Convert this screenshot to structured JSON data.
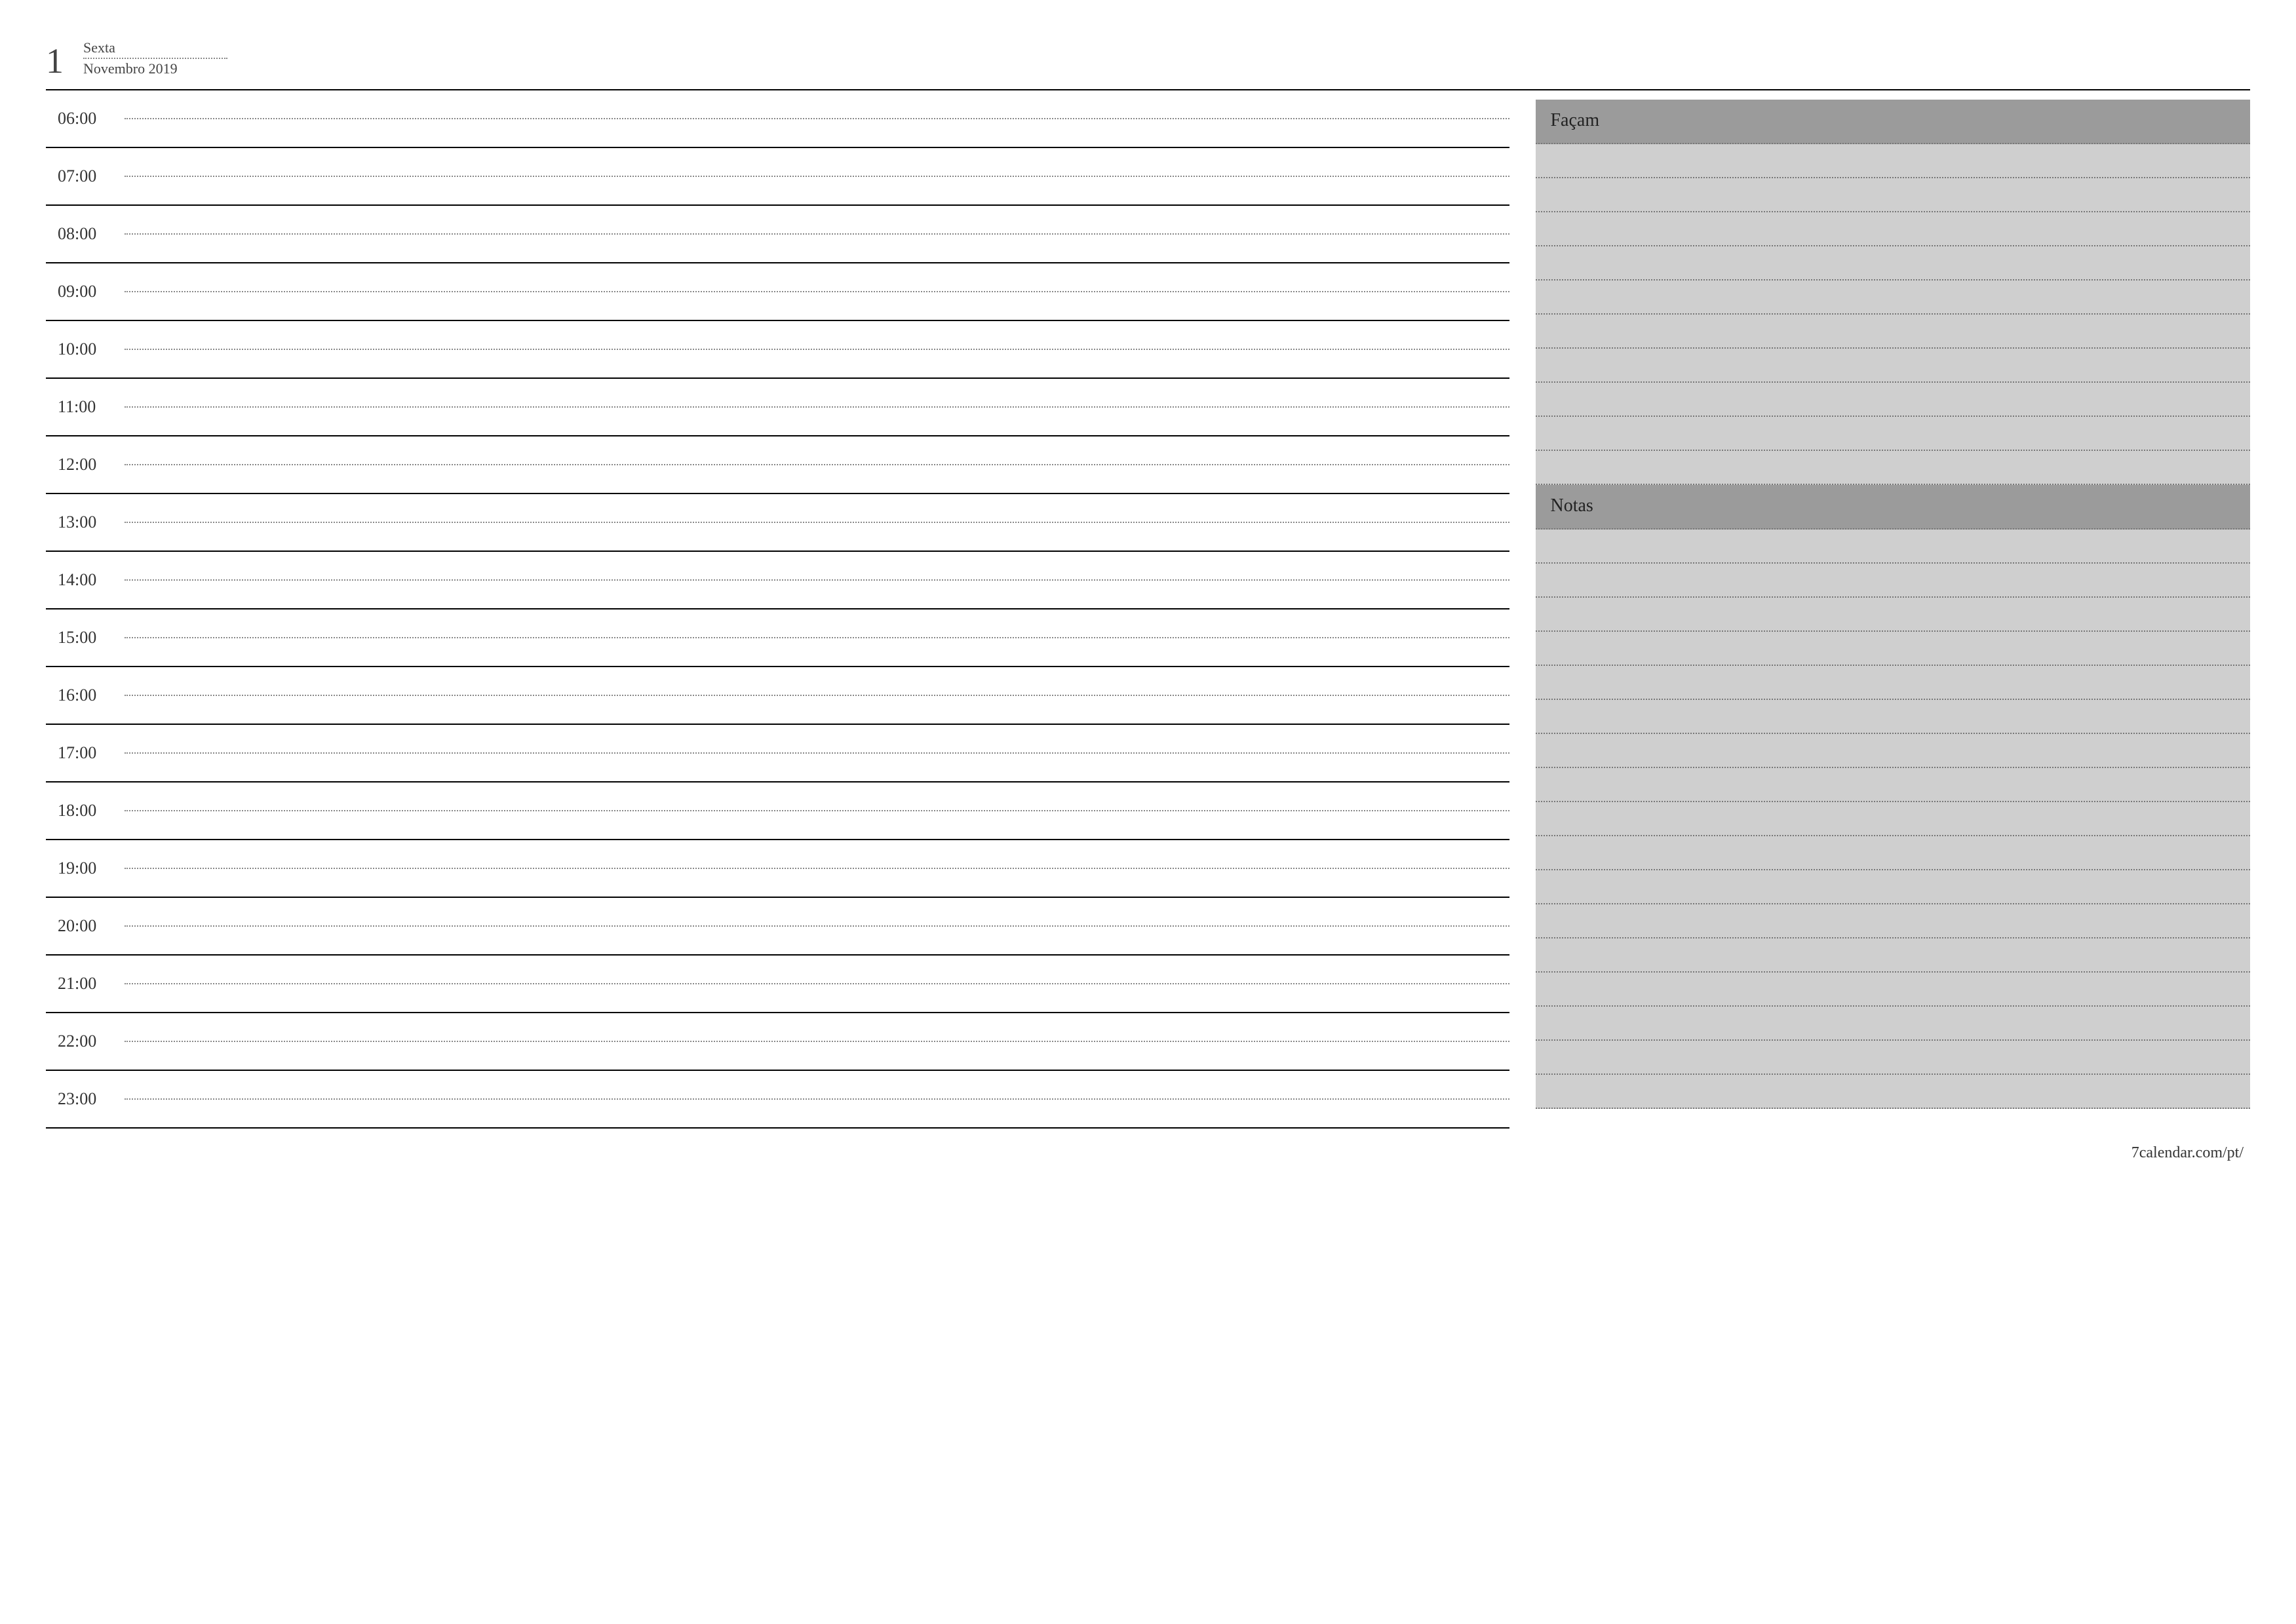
{
  "header": {
    "day_number": "1",
    "weekday": "Sexta",
    "month_year": "Novembro 2019"
  },
  "schedule": {
    "hours": [
      "06:00",
      "07:00",
      "08:00",
      "09:00",
      "10:00",
      "11:00",
      "12:00",
      "13:00",
      "14:00",
      "15:00",
      "16:00",
      "17:00",
      "18:00",
      "19:00",
      "20:00",
      "21:00",
      "22:00",
      "23:00"
    ]
  },
  "sidebar": {
    "todo_label": "Façam",
    "todo_lines": 10,
    "notes_label": "Notas",
    "notes_lines": 17
  },
  "footer": {
    "url": "7calendar.com/pt/"
  }
}
